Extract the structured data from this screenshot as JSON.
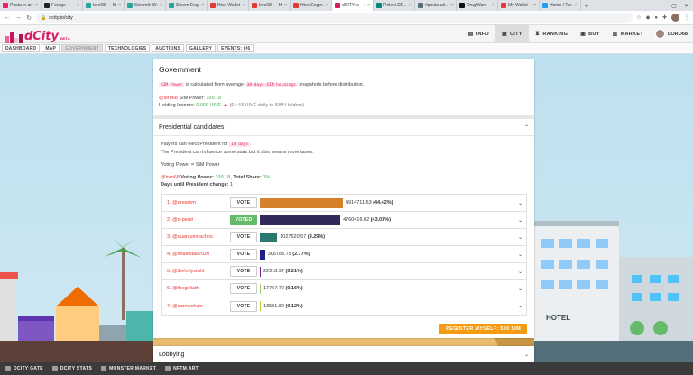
{
  "browser": {
    "tabs": [
      {
        "title": "Posta in arr…",
        "color": "#e91e63",
        "active": false
      },
      {
        "title": "Forage —",
        "color": "#222222",
        "active": false
      },
      {
        "title": "loro68 — St…",
        "color": "#26a69a",
        "active": false
      },
      {
        "title": "Steemit: W…",
        "color": "#26a69a",
        "active": false
      },
      {
        "title": "Steem Eng…",
        "color": "#26a69a",
        "active": false
      },
      {
        "title": "Hive Wallet",
        "color": "#e53935",
        "active": false
      },
      {
        "title": "loro68 — H…",
        "color": "#e53935",
        "active": false
      },
      {
        "title": "Hive Engin…",
        "color": "#e53935",
        "active": false
      },
      {
        "title": "dCITY.io - …",
        "color": "#d81b60",
        "active": true
      },
      {
        "title": "Poloni DE…",
        "color": "#00897b",
        "active": false
      },
      {
        "title": "#posta-uti…",
        "color": "#546e7a",
        "active": false
      },
      {
        "title": "DrugWars",
        "color": "#111111",
        "active": false
      },
      {
        "title": "My Wallet",
        "color": "#e53935",
        "active": false
      },
      {
        "title": "Home / Tw…",
        "color": "#1da1f2",
        "active": false
      }
    ],
    "url": "dcity.io/city",
    "new_tab": "+",
    "close": "×"
  },
  "app": {
    "logo": "dCity",
    "beta": "BETA",
    "nav": [
      {
        "label": "INFO",
        "icon": "info-icon",
        "glyph": "▤",
        "active": false
      },
      {
        "label": "CITY",
        "icon": "city-icon",
        "glyph": "▦",
        "active": true
      },
      {
        "label": "RANKING",
        "icon": "trophy-icon",
        "glyph": "♜",
        "active": false
      },
      {
        "label": "BUY",
        "icon": "buy-icon",
        "glyph": "▣",
        "active": false
      },
      {
        "label": "MARKET",
        "icon": "market-icon",
        "glyph": "▥",
        "active": false
      }
    ],
    "user": "LORO68",
    "subnav": [
      {
        "label": "DASHBOARD",
        "active": false
      },
      {
        "label": "MAP",
        "active": false
      },
      {
        "label": "GOVERNMENT",
        "active": true
      },
      {
        "label": "TECHNOLOGIES",
        "active": false
      },
      {
        "label": "AUCTIONS",
        "active": false
      },
      {
        "label": "GALLERY",
        "active": false
      },
      {
        "label": "EVENTS: 0/6",
        "active": false
      }
    ]
  },
  "government": {
    "title": "Government",
    "pill1": "SIM Power",
    "desc_mid": " is calculated from average ",
    "pill2": "30 days SIM holdings",
    "desc_end": " snapshots before distribution.",
    "user": "@loro68",
    "sim_power_label": " SIM Power: ",
    "sim_power": "199.18",
    "holding_label": "Holding Income: ",
    "holding_value": "0.000 HIVE",
    "holding_note": "(64.43 HIVE daily to SIM Holders)"
  },
  "presidential": {
    "title": "Presidential candidates",
    "elect_text": "Players can elect President for ",
    "elect_pill": "14 days",
    "elect_end": ".",
    "influence": "The President can influence some stats but it also means more taxes.",
    "voting_rule": "Voting Power = SIM Power",
    "user": "@loro68",
    "vp_label": " Voting Power: ",
    "vp_value": "199.18",
    "share_label": ", Total Share: ",
    "share_value": "0%",
    "days_label": "Days until President change: ",
    "days_value": "1",
    "register": "REGISTER MYSELF: 500 SIM",
    "candidates": [
      {
        "rank": "1. @dreamm",
        "button": "VOTE",
        "voted": false,
        "value": "4914711.63",
        "percent": "(44.42%)",
        "share": 0.4442,
        "color": "#d4812a"
      },
      {
        "rank": "2. @d-pend",
        "button": "VOTED",
        "voted": true,
        "value": "4760416.02",
        "percent": "(43.03%)",
        "share": 0.4303,
        "color": "#2f2a5a"
      },
      {
        "rank": "3. @quantumnachos",
        "button": "VOTE",
        "voted": false,
        "value": "1027520.57",
        "percent": "(9.29%)",
        "share": 0.0929,
        "color": "#2a7870"
      },
      {
        "rank": "4. @shaktidas2020",
        "button": "VOTE",
        "voted": false,
        "value": "306783.75",
        "percent": "(2.77%)",
        "share": 0.0277,
        "color": "#1f1f8a"
      },
      {
        "rank": "5. @theholystuhl",
        "button": "VOTE",
        "voted": false,
        "value": "22918.97",
        "percent": "(0.21%)",
        "share": 0.0021,
        "color": "#7b1fa2"
      },
      {
        "rank": "6. @thegoliath",
        "button": "VOTE",
        "voted": false,
        "value": "17767.70",
        "percent": "(0.16%)",
        "share": 0.0016,
        "color": "#9ccc65"
      },
      {
        "rank": "7. @dannychain",
        "button": "VOTE",
        "voted": false,
        "value": "13591.80",
        "percent": "(0.12%)",
        "share": 0.0012,
        "color": "#c0ca33"
      }
    ]
  },
  "lobbying": {
    "title": "Lobbying"
  },
  "scene": {
    "hotel": "HOTEL"
  },
  "footer": [
    "DCITY GATE",
    "DCITY STATS",
    "MONSTER MARKET",
    "NFTM.ART"
  ]
}
